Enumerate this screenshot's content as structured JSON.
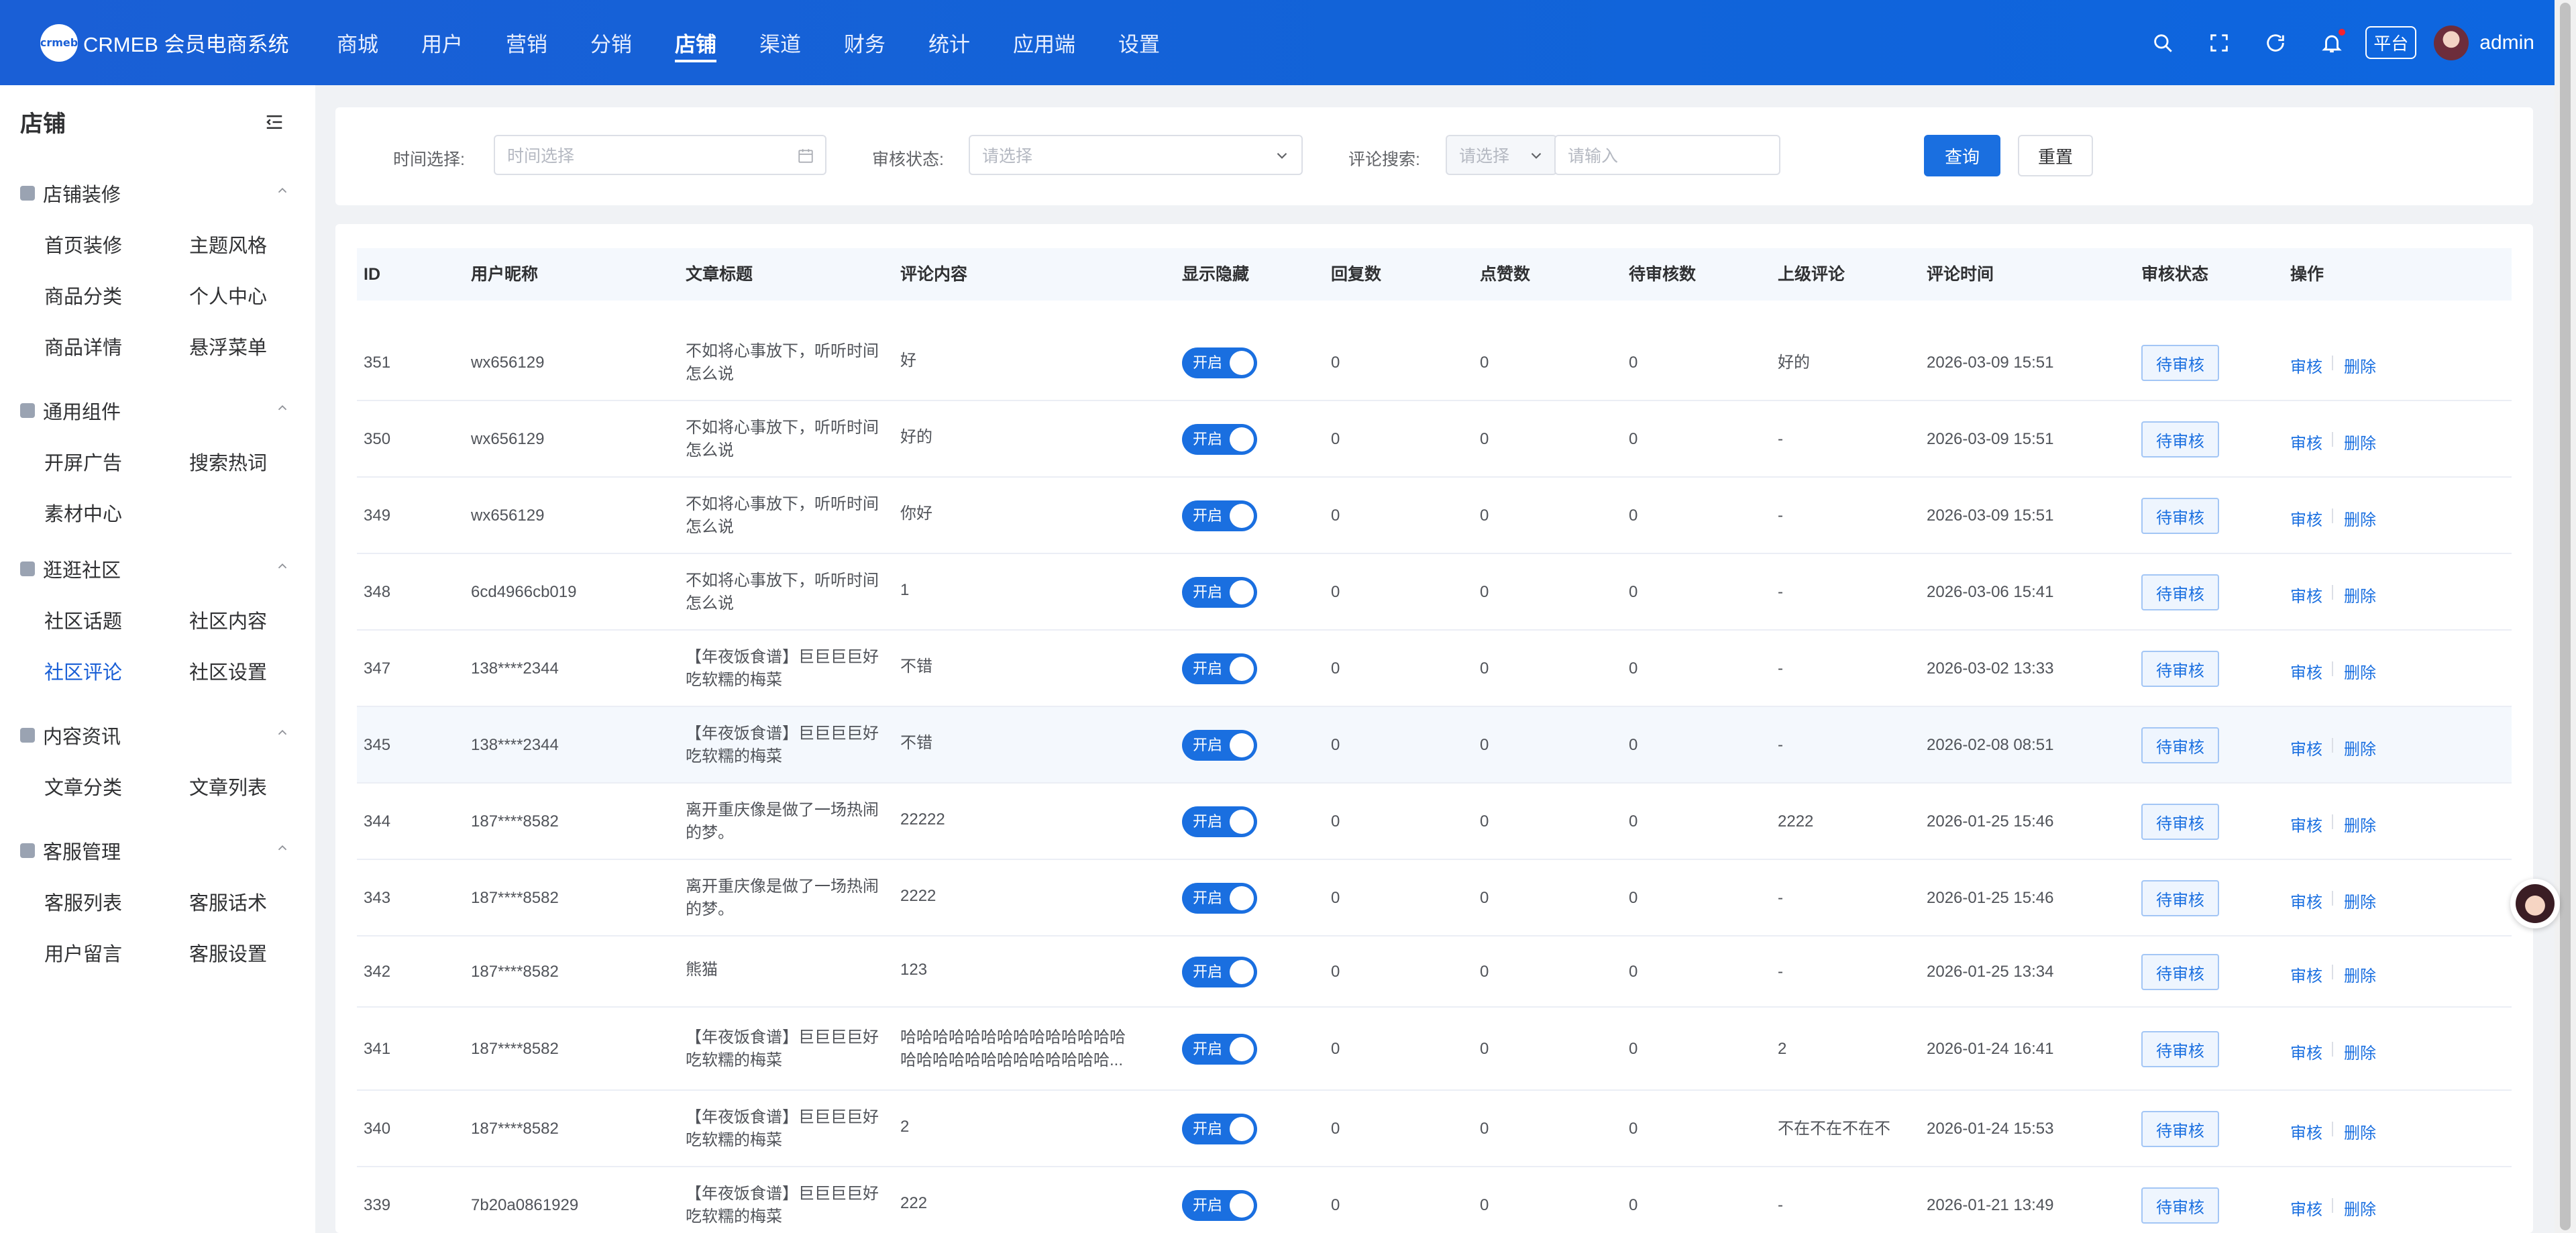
{
  "brand": {
    "logo_text": "crmeb",
    "name": "CRMEB 会员电商系统"
  },
  "topnav": [
    "商城",
    "用户",
    "营销",
    "分销",
    "店铺",
    "渠道",
    "财务",
    "统计",
    "应用端",
    "设置"
  ],
  "topnav_active": "店铺",
  "header": {
    "platform_badge": "平台",
    "username": "admin",
    "icons": [
      "search-icon",
      "fullscreen-icon",
      "refresh-icon",
      "bell-icon"
    ]
  },
  "sidebar": {
    "title": "店铺",
    "groups": [
      {
        "title": "店铺装修",
        "items": [
          "首页装修",
          "主题风格",
          "商品分类",
          "个人中心",
          "商品详情",
          "悬浮菜单"
        ]
      },
      {
        "title": "通用组件",
        "items": [
          "开屏广告",
          "搜索热词",
          "素材中心"
        ]
      },
      {
        "title": "逛逛社区",
        "items": [
          "社区话题",
          "社区内容",
          "社区评论",
          "社区设置"
        ]
      },
      {
        "title": "内容资讯",
        "items": [
          "文章分类",
          "文章列表"
        ]
      },
      {
        "title": "客服管理",
        "items": [
          "客服列表",
          "客服话术",
          "用户留言",
          "客服设置"
        ]
      }
    ],
    "active_item": "社区评论"
  },
  "filters": {
    "time_label": "时间选择:",
    "time_placeholder": "时间选择",
    "status_label": "审核状态:",
    "status_placeholder": "请选择",
    "search_label": "评论搜索:",
    "search_type_placeholder": "请选择",
    "search_placeholder": "请输入",
    "query_button": "查询",
    "reset_button": "重置"
  },
  "table": {
    "columns": [
      "ID",
      "用户昵称",
      "文章标题",
      "评论内容",
      "显示隐藏",
      "回复数",
      "点赞数",
      "待审核数",
      "上级评论",
      "评论时间",
      "审核状态",
      "操作"
    ],
    "switch_label": "开启",
    "status_label": "待审核",
    "action_review": "审核",
    "action_delete": "删除",
    "rows": [
      {
        "id": "351",
        "user": "wx656129",
        "title_l1": "不如将心事放下，听听时间",
        "title_l2": "怎么说",
        "content_l1": "好",
        "content_l2": "",
        "replies": "0",
        "likes": "0",
        "pending": "0",
        "parent": "好的",
        "time": "2026-03-09 15:51"
      },
      {
        "id": "350",
        "user": "wx656129",
        "title_l1": "不如将心事放下，听听时间",
        "title_l2": "怎么说",
        "content_l1": "好的",
        "content_l2": "",
        "replies": "0",
        "likes": "0",
        "pending": "0",
        "parent": "-",
        "time": "2026-03-09 15:51"
      },
      {
        "id": "349",
        "user": "wx656129",
        "title_l1": "不如将心事放下，听听时间",
        "title_l2": "怎么说",
        "content_l1": "你好",
        "content_l2": "",
        "replies": "0",
        "likes": "0",
        "pending": "0",
        "parent": "-",
        "time": "2026-03-09 15:51"
      },
      {
        "id": "348",
        "user": "6cd4966cb019",
        "title_l1": "不如将心事放下，听听时间",
        "title_l2": "怎么说",
        "content_l1": "1",
        "content_l2": "",
        "replies": "0",
        "likes": "0",
        "pending": "0",
        "parent": "-",
        "time": "2026-03-06 15:41"
      },
      {
        "id": "347",
        "user": "138****2344",
        "title_l1": "【年夜饭食谱】巨巨巨巨好",
        "title_l2": "吃软糯的梅菜",
        "content_l1": "不错",
        "content_l2": "",
        "replies": "0",
        "likes": "0",
        "pending": "0",
        "parent": "-",
        "time": "2026-03-02 13:33"
      },
      {
        "id": "345",
        "user": "138****2344",
        "title_l1": "【年夜饭食谱】巨巨巨巨好",
        "title_l2": "吃软糯的梅菜",
        "content_l1": "不错",
        "content_l2": "",
        "replies": "0",
        "likes": "0",
        "pending": "0",
        "parent": "-",
        "time": "2026-02-08 08:51"
      },
      {
        "id": "344",
        "user": "187****8582",
        "title_l1": "离开重庆像是做了一场热闹",
        "title_l2": "的梦。",
        "content_l1": "22222",
        "content_l2": "",
        "replies": "0",
        "likes": "0",
        "pending": "0",
        "parent": "2222",
        "time": "2026-01-25 15:46"
      },
      {
        "id": "343",
        "user": "187****8582",
        "title_l1": "离开重庆像是做了一场热闹",
        "title_l2": "的梦。",
        "content_l1": "2222",
        "content_l2": "",
        "replies": "0",
        "likes": "0",
        "pending": "0",
        "parent": "-",
        "time": "2026-01-25 15:46"
      },
      {
        "id": "342",
        "user": "187****8582",
        "title_l1": "熊猫",
        "title_l2": "",
        "content_l1": "123",
        "content_l2": "",
        "replies": "0",
        "likes": "0",
        "pending": "0",
        "parent": "-",
        "time": "2026-01-25 13:34"
      },
      {
        "id": "341",
        "user": "187****8582",
        "title_l1": "【年夜饭食谱】巨巨巨巨好",
        "title_l2": "吃软糯的梅菜",
        "content_l1": "哈哈哈哈哈哈哈哈哈哈哈哈哈哈",
        "content_l2": "哈哈哈哈哈哈哈哈哈哈哈哈哈...",
        "replies": "0",
        "likes": "0",
        "pending": "0",
        "parent": "2",
        "time": "2026-01-24 16:41"
      },
      {
        "id": "340",
        "user": "187****8582",
        "title_l1": "【年夜饭食谱】巨巨巨巨好",
        "title_l2": "吃软糯的梅菜",
        "content_l1": "2",
        "content_l2": "",
        "replies": "0",
        "likes": "0",
        "pending": "0",
        "parent": "不在不在不在不",
        "time": "2026-01-24 15:53"
      },
      {
        "id": "339",
        "user": "7b20a0861929",
        "title_l1": "【年夜饭食谱】巨巨巨巨好",
        "title_l2": "吃软糯的梅菜",
        "content_l1": "222",
        "content_l2": "",
        "replies": "0",
        "likes": "0",
        "pending": "0",
        "parent": "-",
        "time": "2026-01-21 13:49"
      }
    ]
  },
  "colors": {
    "primary": "#1a6fe0",
    "header_bg": "#1263d8",
    "page_bg": "#f0f2f5"
  }
}
